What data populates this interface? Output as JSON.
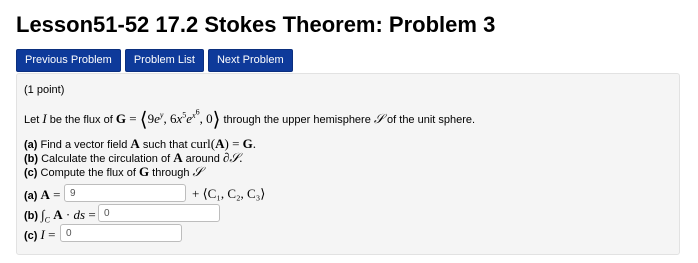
{
  "page_title": "Lesson51-52 17.2 Stokes Theorem: Problem 3",
  "nav": {
    "previous": "Previous Problem",
    "list": "Problem List",
    "next": "Next Problem"
  },
  "problem": {
    "points": "(1 point)",
    "statement_prefix": "Let",
    "statement_mid": "be the flux of",
    "statement_suffix": "through the upper hemisphere",
    "statement_end": "of the unit sphere.",
    "part_a_label": "(a)",
    "part_a_text": "Find a vector field",
    "part_a_text2": "such that",
    "part_b_label": "(b)",
    "part_b_text": "Calculate the circulation of",
    "part_b_text2": "around",
    "part_c_label": "(c)",
    "part_c_text": "Compute the flux of",
    "part_c_text2": "through",
    "answer_a_value": "9",
    "answer_a_suffix": "+ ⟨C₁, C₂, C₃⟩",
    "answer_b_value": "0",
    "answer_c_value": "0"
  }
}
